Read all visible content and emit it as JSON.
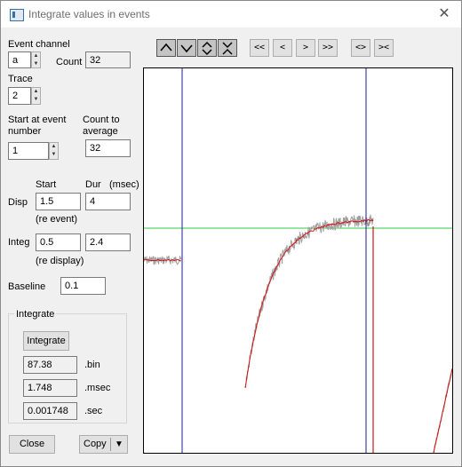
{
  "window": {
    "title": "Integrate values in events"
  },
  "event_channel": {
    "label": "Event channel",
    "value": "a",
    "count_label": "Count",
    "count_value": "32"
  },
  "trace": {
    "label": "Trace",
    "value": "2"
  },
  "start_event": {
    "label_line1": "Start at event",
    "label_line2": "number",
    "value": "1"
  },
  "count_to_average": {
    "label_line1": "Count to",
    "label_line2": "average",
    "value": "32"
  },
  "columns": {
    "start": "Start",
    "dur": "Dur",
    "unit": "(msec)"
  },
  "disp": {
    "label": "Disp",
    "start": "1.5",
    "dur": "4",
    "note": "(re event)"
  },
  "integ": {
    "label": "Integ",
    "start": "0.5",
    "dur": "2.4",
    "note": "(re display)"
  },
  "baseline": {
    "label": "Baseline",
    "value": "0.1"
  },
  "integrate_group": {
    "title": "Integrate",
    "button": "Integrate",
    "results": [
      {
        "value": "87.38",
        "unit": ".bin"
      },
      {
        "value": "1.748",
        "unit": ".msec"
      },
      {
        "value": "0.001748",
        "unit": ".sec"
      }
    ]
  },
  "buttons": {
    "close": "Close",
    "copy": "Copy"
  },
  "toolbar": {
    "shape_buttons": [
      "^",
      "v",
      "<>",
      "><"
    ],
    "nav_buttons": [
      "<<",
      "<",
      ">",
      ">>"
    ],
    "zoom_buttons": [
      "<>",
      "><"
    ]
  },
  "colors": {
    "trace_raw": "#a0a0a0",
    "trace_avg": "#d21414",
    "cursor": "#1e1e8c",
    "baseline_line": "#2ecc40"
  }
}
